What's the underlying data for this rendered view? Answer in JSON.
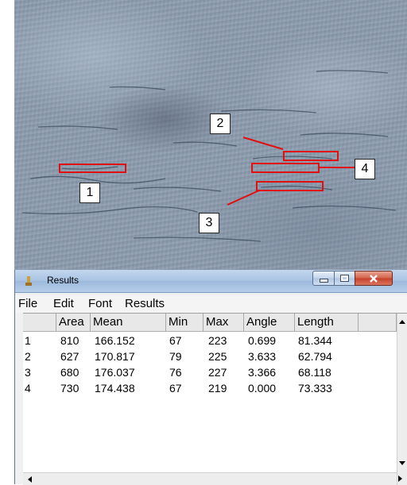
{
  "annotations": {
    "labels": [
      "1",
      "2",
      "3",
      "4"
    ],
    "roi_color": "#e01010"
  },
  "window": {
    "title": "Results",
    "icon": "imagej-icon",
    "controls": [
      "minimize-icon",
      "maximize-icon",
      "close-icon"
    ]
  },
  "menu": [
    "File",
    "Edit",
    "Font",
    "Results"
  ],
  "table": {
    "columns": [
      "",
      "Area",
      "Mean",
      "Min",
      "Max",
      "Angle",
      "Length",
      ""
    ],
    "rows": [
      [
        "1",
        "810",
        "166.152",
        "67",
        "223",
        "0.699",
        "81.344"
      ],
      [
        "2",
        "627",
        "170.817",
        "79",
        "225",
        "3.633",
        "62.794"
      ],
      [
        "3",
        "680",
        "176.037",
        "76",
        "227",
        "3.366",
        "68.118"
      ],
      [
        "4",
        "730",
        "174.438",
        "67",
        "219",
        "0.000",
        "73.333"
      ]
    ]
  }
}
